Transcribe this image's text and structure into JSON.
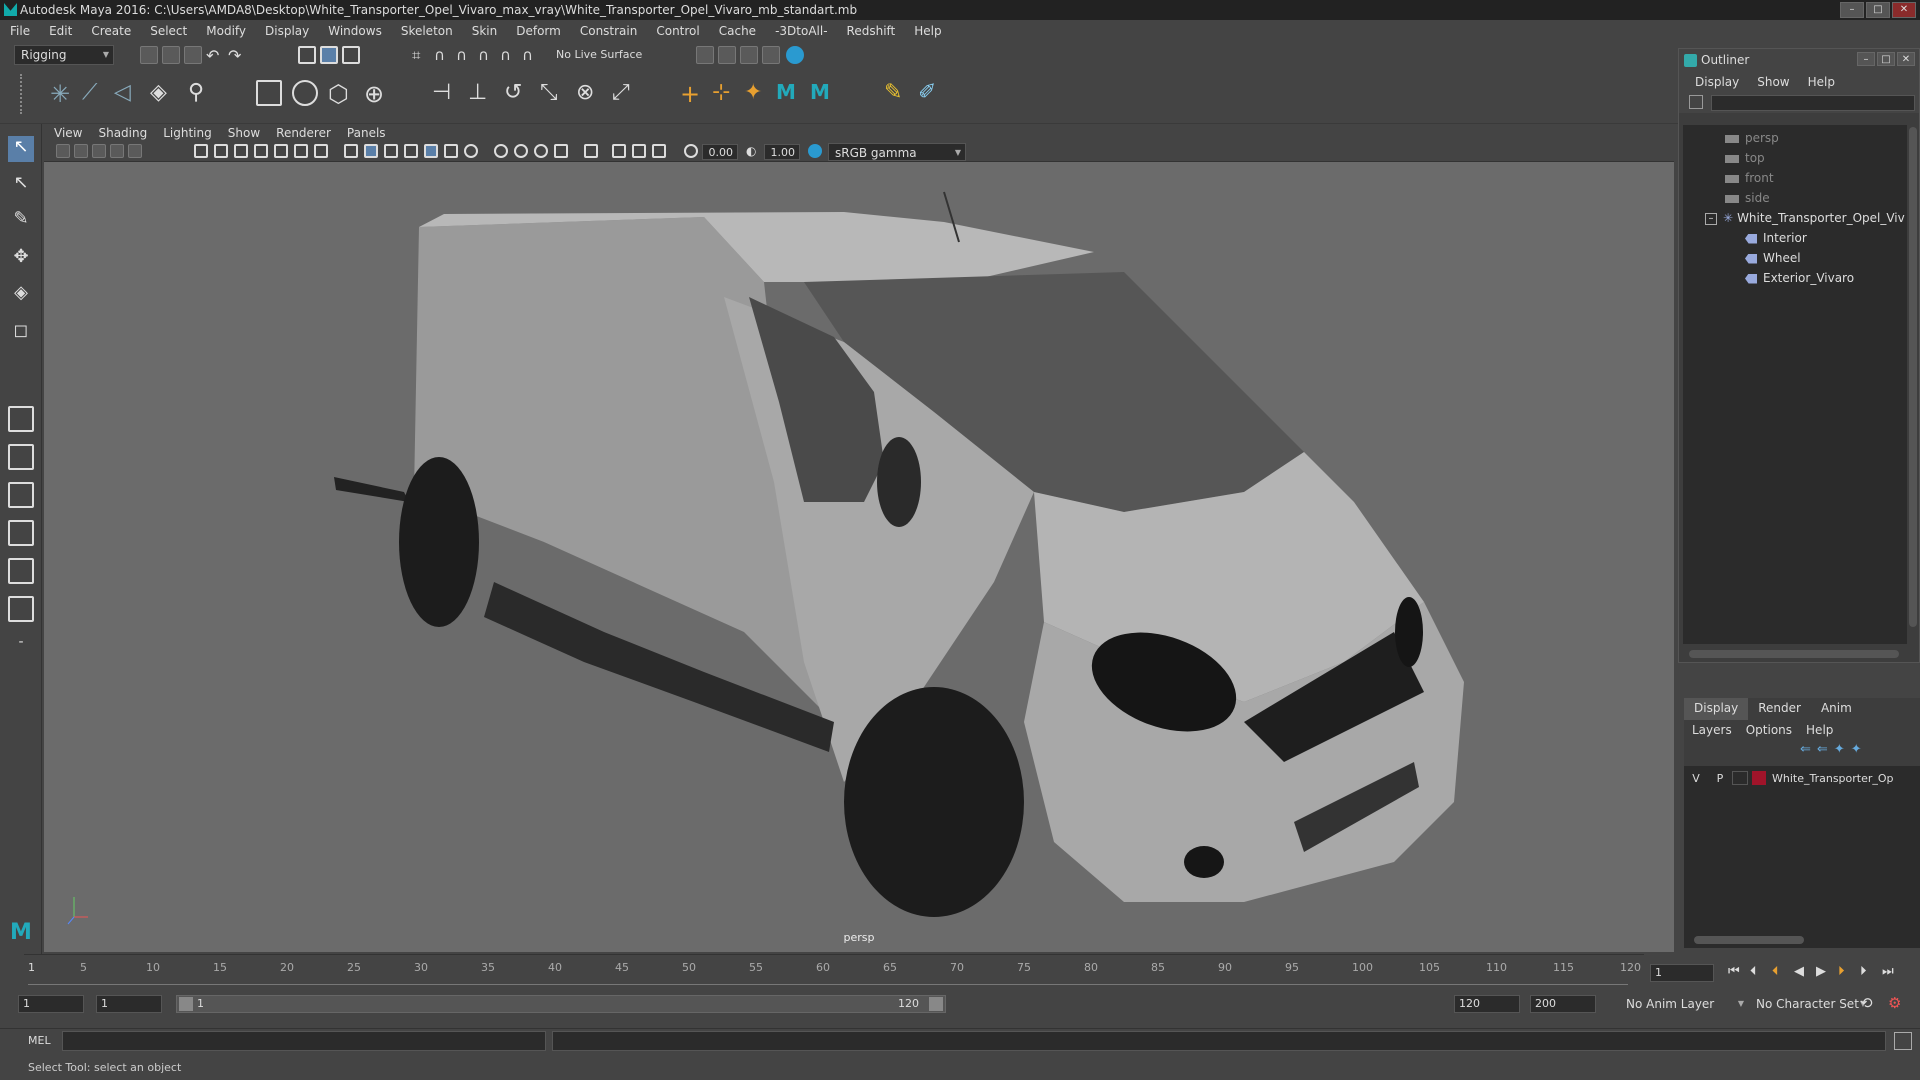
{
  "app": {
    "title": "Autodesk Maya 2016: C:\\Users\\AMDA8\\Desktop\\White_Transporter_Opel_Vivaro_max_vray\\White_Transporter_Opel_Vivaro_mb_standart.mb"
  },
  "menu": [
    "File",
    "Edit",
    "Create",
    "Select",
    "Modify",
    "Display",
    "Windows",
    "Skeleton",
    "Skin",
    "Deform",
    "Constrain",
    "Control",
    "Cache",
    "-3DtoAll-",
    "Redshift",
    "Help"
  ],
  "toolbar": {
    "mode": "Rigging",
    "live_surface": "No Live Surface"
  },
  "panel": {
    "menu": [
      "View",
      "Shading",
      "Lighting",
      "Show",
      "Renderer",
      "Panels"
    ],
    "exposure": "0.00",
    "gamma": "1.00",
    "colorspace": "sRGB gamma",
    "camera_label": "persp"
  },
  "outliner": {
    "title": "Outliner",
    "menu": [
      "Display",
      "Show",
      "Help"
    ],
    "items": [
      {
        "label": "persp",
        "type": "camera"
      },
      {
        "label": "top",
        "type": "camera"
      },
      {
        "label": "front",
        "type": "camera"
      },
      {
        "label": "side",
        "type": "camera"
      },
      {
        "label": "White_Transporter_Opel_Vivaro",
        "type": "root"
      },
      {
        "label": "Interior",
        "type": "group"
      },
      {
        "label": "Wheel",
        "type": "group"
      },
      {
        "label": "Exterior_Vivaro",
        "type": "group"
      }
    ]
  },
  "layers": {
    "tabs": [
      "Display",
      "Render",
      "Anim"
    ],
    "menu": [
      "Layers",
      "Options",
      "Help"
    ],
    "rows": [
      {
        "v": "V",
        "p": "P",
        "name": "White_Transporter_Op",
        "color": "#a0142a"
      }
    ]
  },
  "timeline": {
    "ticks": [
      "5",
      "10",
      "15",
      "20",
      "25",
      "30",
      "35",
      "40",
      "45",
      "50",
      "55",
      "60",
      "65",
      "70",
      "75",
      "80",
      "85",
      "90",
      "95",
      "100",
      "105",
      "110",
      "115",
      "120"
    ],
    "start_marker": "1",
    "current_frame": "1"
  },
  "range": {
    "start": "1",
    "playback_start": "1",
    "slider_start": "1",
    "slider_end": "120",
    "playback_end": "120",
    "end": "200",
    "anim_layer": "No Anim Layer",
    "char_set": "No Character Set"
  },
  "mel": {
    "label": "MEL"
  },
  "status": {
    "text": "Select Tool: select an object"
  }
}
